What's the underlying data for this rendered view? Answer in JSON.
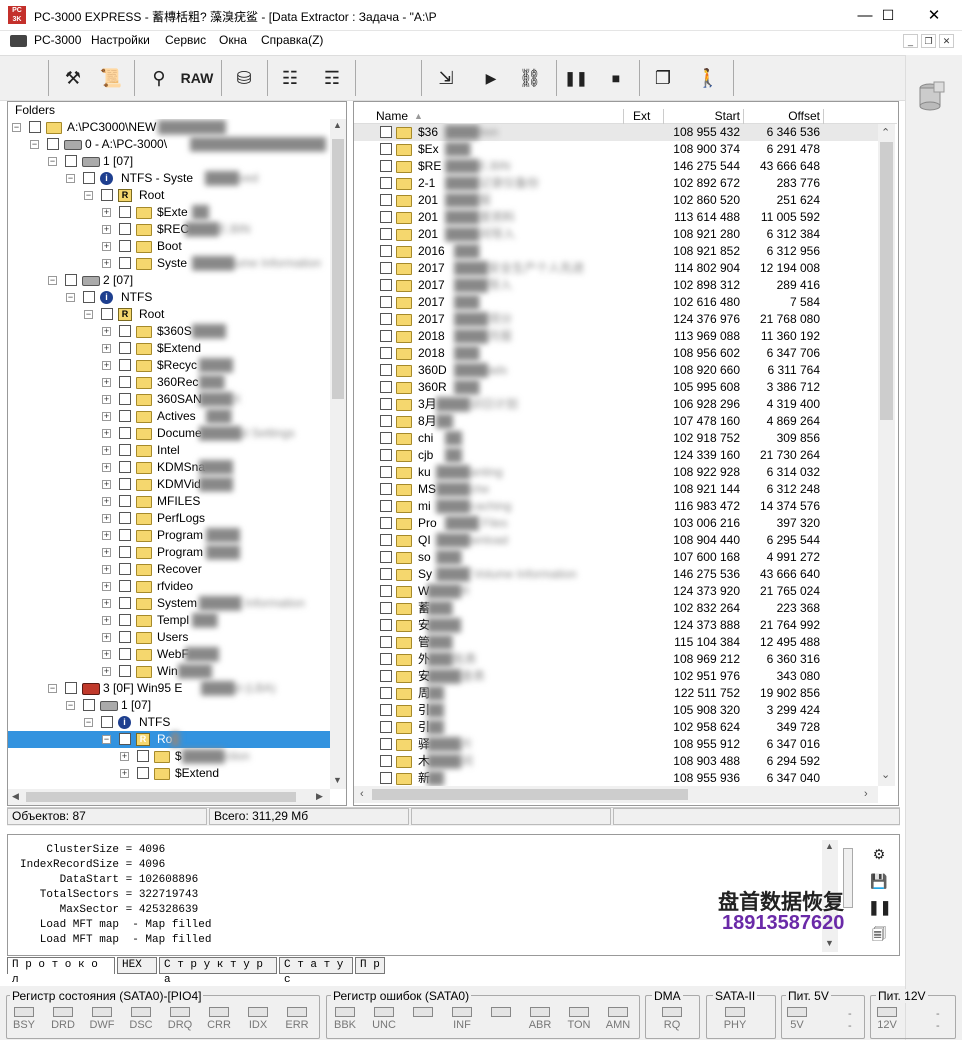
{
  "window": {
    "title": "PC-3000 EXPRESS - 蓄槫栝粗? 藻溴疣鲨    - [Data Extractor : Задача - \"A:\\P",
    "icon_text": "PC 3K",
    "controls": [
      "—",
      "☐",
      "✕"
    ]
  },
  "menubar": {
    "items": [
      "PC-3000",
      "Настройки",
      "Сервис",
      "Окна",
      "Справка(Z)"
    ],
    "mdi_controls": [
      "_",
      "❐",
      "✕"
    ]
  },
  "toolbar": {
    "raw_label": "RAW",
    "icons": [
      "tools-icon",
      "scroll-icon",
      "binoculars-icon",
      "raw-icon",
      "open-drive-icon",
      "tree-icon",
      "tree-disk-icon",
      "extract-icon",
      "play-icon",
      "connect-icon",
      "pause-icon",
      "stop-icon",
      "windows-icon",
      "exit-icon"
    ]
  },
  "tree": {
    "header": "Folders",
    "rows": [
      {
        "label": "A:\\PC3000\\NEW",
        "blur": "████████",
        "level": 0,
        "icon": "project",
        "exp": "−"
      },
      {
        "label": "0 - A:\\PC-3000\\",
        "blur": "████████████████",
        "level": 1,
        "icon": "disk",
        "exp": "−"
      },
      {
        "label": "1 [07]",
        "blur": "",
        "level": 2,
        "icon": "disk",
        "exp": "−"
      },
      {
        "label": "NTFS - Syste",
        "blur": "████ved",
        "level": 3,
        "icon": "info",
        "exp": "−"
      },
      {
        "label": "Root",
        "blur": "",
        "level": 4,
        "icon": "root",
        "exp": "−"
      },
      {
        "label": "$Exte",
        "blur": "██",
        "level": 5,
        "icon": "folder",
        "exp": "+"
      },
      {
        "label": "$REC",
        "blur": "████E.BIN",
        "level": 5,
        "icon": "folder",
        "exp": "+"
      },
      {
        "label": "Boot",
        "blur": "",
        "level": 5,
        "icon": "folder",
        "exp": "+"
      },
      {
        "label": "Syste",
        "blur": "█████ume Information",
        "level": 5,
        "icon": "folder",
        "exp": "+"
      },
      {
        "label": "2 [07]",
        "blur": "",
        "level": 2,
        "icon": "disk",
        "exp": "−"
      },
      {
        "label": "NTFS",
        "blur": "",
        "level": 3,
        "icon": "info",
        "exp": "−"
      },
      {
        "label": "Root",
        "blur": "",
        "level": 4,
        "icon": "root",
        "exp": "−"
      },
      {
        "label": "$360S",
        "blur": "████",
        "level": 5,
        "icon": "folder",
        "exp": "+"
      },
      {
        "label": "$Extend",
        "blur": "",
        "level": 5,
        "icon": "folder",
        "exp": "+"
      },
      {
        "label": "$Recyc",
        "blur": "████",
        "level": 5,
        "icon": "folder",
        "exp": "+"
      },
      {
        "label": "360Rec",
        "blur": "███",
        "level": 5,
        "icon": "folder",
        "exp": "+"
      },
      {
        "label": "360SAN",
        "blur": "████X",
        "level": 5,
        "icon": "folder",
        "exp": "+"
      },
      {
        "label": "Actives",
        "blur": "███",
        "level": 5,
        "icon": "folder",
        "exp": "+"
      },
      {
        "label": "Docume",
        "blur": "█████d Settings",
        "level": 5,
        "icon": "folder",
        "exp": "+"
      },
      {
        "label": "Intel",
        "blur": "",
        "level": 5,
        "icon": "folder",
        "exp": "+"
      },
      {
        "label": "KDMSna",
        "blur": "████",
        "level": 5,
        "icon": "folder",
        "exp": "+"
      },
      {
        "label": "KDMVid",
        "blur": "████",
        "level": 5,
        "icon": "folder",
        "exp": "+"
      },
      {
        "label": "MFILES",
        "blur": "",
        "level": 5,
        "icon": "folder",
        "exp": "+"
      },
      {
        "label": "PerfLogs",
        "blur": "",
        "level": 5,
        "icon": "folder",
        "exp": "+"
      },
      {
        "label": "Program",
        "blur": "████",
        "level": 5,
        "icon": "folder",
        "exp": "+"
      },
      {
        "label": "Program",
        "blur": "████",
        "level": 5,
        "icon": "folder",
        "exp": "+"
      },
      {
        "label": "Recover",
        "blur": "",
        "level": 5,
        "icon": "folder",
        "exp": "+"
      },
      {
        "label": "rfvideo",
        "blur": "",
        "level": 5,
        "icon": "folder",
        "exp": "+"
      },
      {
        "label": "System",
        "blur": "█████ Information",
        "level": 5,
        "icon": "folder",
        "exp": "+"
      },
      {
        "label": "Templ",
        "blur": "███",
        "level": 5,
        "icon": "folder",
        "exp": "+"
      },
      {
        "label": "Users",
        "blur": "",
        "level": 5,
        "icon": "folder",
        "exp": "+"
      },
      {
        "label": "WebF",
        "blur": "████",
        "level": 5,
        "icon": "folder",
        "exp": "+"
      },
      {
        "label": "Win",
        "blur": "████",
        "level": 5,
        "icon": "folder",
        "exp": "+"
      },
      {
        "label": "3 [0F] Win95 E",
        "blur": "████d  (LBA)",
        "level": 2,
        "icon": "hdd",
        "exp": "−"
      },
      {
        "label": "1 [07]",
        "blur": "",
        "level": 3,
        "icon": "disk",
        "exp": "−"
      },
      {
        "label": "NTFS",
        "blur": "",
        "level": 4,
        "icon": "info",
        "exp": "−"
      },
      {
        "label": "Ro",
        "blur": "█",
        "level": 5,
        "icon": "root",
        "exp": "−",
        "selected": true
      },
      {
        "label": "$",
        "blur": "█████ction",
        "level": 6,
        "icon": "folder",
        "exp": "+"
      },
      {
        "label": "$Extend",
        "blur": "",
        "level": 6,
        "icon": "folder",
        "exp": "+"
      }
    ]
  },
  "list": {
    "columns": [
      "Name",
      "Ext",
      "Start",
      "Offset"
    ],
    "rows": [
      {
        "name": "$36",
        "blur": "████tion",
        "start": "108 955 432",
        "offset": "6 346 536"
      },
      {
        "name": "$Ex",
        "blur": "███",
        "start": "108 900 374",
        "offset": "6 291 478"
      },
      {
        "name": "$RE",
        "blur": "████E.BIN",
        "start": "146 275 544",
        "offset": "43 666 648"
      },
      {
        "name": "2-1",
        "blur": "████记录仪备份",
        "start": "102 892 672",
        "offset": "283 776"
      },
      {
        "name": "201",
        "blur": "████报",
        "start": "102 860 520",
        "offset": "251 624"
      },
      {
        "name": "201",
        "blur": "████度资料",
        "start": "113 614 488",
        "offset": "11 005 592"
      },
      {
        "name": "201",
        "blur": "████间导入",
        "start": "108 921 280",
        "offset": "6 312 384"
      },
      {
        "name": "2016",
        "blur": "███",
        "start": "108 921 852",
        "offset": "6 312 956"
      },
      {
        "name": "2017",
        "blur": "████安全生产个人先进",
        "start": "114 802 904",
        "offset": "12 194 008"
      },
      {
        "name": "2017",
        "blur": "████导入",
        "start": "102 898 312",
        "offset": "289 416"
      },
      {
        "name": "2017",
        "blur": "███",
        "start": "102 616 480",
        "offset": "7 584"
      },
      {
        "name": "2017",
        "blur": "████项分",
        "start": "124 376 976",
        "offset": "21 768 080"
      },
      {
        "name": "2018",
        "blur": "████月报",
        "start": "113 969 088",
        "offset": "11 360 192"
      },
      {
        "name": "2018",
        "blur": "███",
        "start": "108 956 602",
        "offset": "6 347 706"
      },
      {
        "name": "360D",
        "blur": "████ads",
        "start": "108 920 660",
        "offset": "6 311 764"
      },
      {
        "name": "360R",
        "blur": "███",
        "start": "105 995 608",
        "offset": "3 386 712"
      },
      {
        "name": "3月",
        "blur": "████训日计划",
        "start": "106 928 296",
        "offset": "4 319 400"
      },
      {
        "name": "8月",
        "blur": "██",
        "start": "107 478 160",
        "offset": "4 869 264"
      },
      {
        "name": "chi",
        "blur": "██",
        "start": "102 918 752",
        "offset": "309 856"
      },
      {
        "name": "cjb",
        "blur": "██",
        "start": "124 339 160",
        "offset": "21 730 264"
      },
      {
        "name": "ku",
        "blur": "████anting",
        "start": "108 922 928",
        "offset": "6 314 032"
      },
      {
        "name": "MS",
        "blur": "████che",
        "start": "108 921 144",
        "offset": "6 312 248"
      },
      {
        "name": "mi",
        "blur": "████caching",
        "start": "116 983 472",
        "offset": "14 374 576"
      },
      {
        "name": "Pro",
        "blur": "████ Files",
        "start": "103 006 216",
        "offset": "397 320"
      },
      {
        "name": "QI",
        "blur": "████wnload",
        "start": "108 904 440",
        "offset": "6 295 544"
      },
      {
        "name": "so",
        "blur": "███",
        "start": "107 600 168",
        "offset": "4 991 272"
      },
      {
        "name": "Sy",
        "blur": "████ Volume Information",
        "start": "146 275 536",
        "offset": "43 666 640"
      },
      {
        "name": "W",
        "blur": "████R",
        "start": "124 373 920",
        "offset": "21 765 024"
      },
      {
        "name": "蓄",
        "blur": "███",
        "start": "102 832 264",
        "offset": "223 368"
      },
      {
        "name": "安",
        "blur": "████",
        "start": "124 373 888",
        "offset": "21 764 992"
      },
      {
        "name": "管",
        "blur": "███",
        "start": "115 104 384",
        "offset": "12 495 488"
      },
      {
        "name": "外",
        "blur": "███批表",
        "start": "108 969 212",
        "offset": "6 360 316"
      },
      {
        "name": "安",
        "blur": "████查表",
        "start": "102 951 976",
        "offset": "343 080"
      },
      {
        "name": "周",
        "blur": "██",
        "start": "122 511 752",
        "offset": "19 902 856"
      },
      {
        "name": "引",
        "blur": "██",
        "start": "105 908 320",
        "offset": "3 299 424"
      },
      {
        "name": "引",
        "blur": "██",
        "start": "102 958 624",
        "offset": "349 728"
      },
      {
        "name": "驿",
        "blur": "████片",
        "start": "108 955 912",
        "offset": "6 347 016"
      },
      {
        "name": "木",
        "blur": "████间",
        "start": "108 903 488",
        "offset": "6 294 592"
      },
      {
        "name": "新",
        "blur": "██",
        "start": "108 955 936",
        "offset": "6 347 040"
      }
    ]
  },
  "status": {
    "objects": "Объектов: 87",
    "total": "Всего: 311,29 Мб"
  },
  "log": {
    "lines": [
      "    ClusterSize = 4096",
      "IndexRecordSize = 4096",
      "      DataStart = 102608896",
      "   TotalSectors = 322719743",
      "      MaxSector = 425328639",
      "   Load MFT map  - Map filled",
      "   Load MFT map  - Map filled"
    ],
    "tabs": [
      "П р о т о к о л",
      "HEX",
      "С т р у к т у р а",
      "С т а т у с",
      "П р"
    ]
  },
  "watermark": {
    "line1": "盘首数据恢复",
    "line2": "18913587620"
  },
  "registers": {
    "status_title": "Регистр состояния (SATA0)-[PIO4]",
    "status_leds": [
      "BSY",
      "DRD",
      "DWF",
      "DSC",
      "DRQ",
      "CRR",
      "IDX",
      "ERR"
    ],
    "error_title": "Регистр ошибок  (SATA0)",
    "error_leds": [
      "BBK",
      "UNC",
      "",
      "INF",
      "",
      "ABR",
      "TON",
      "AMN"
    ],
    "dma_title": "DMA",
    "dma_led": "RQ",
    "sata_title": "SATA-II",
    "sata_led": "PHY",
    "p5_title": "Пит. 5V",
    "p5_led": "5V",
    "p5_value": "--",
    "p12_title": "Пит. 12V",
    "p12_led": "12V",
    "p12_value": "--"
  }
}
